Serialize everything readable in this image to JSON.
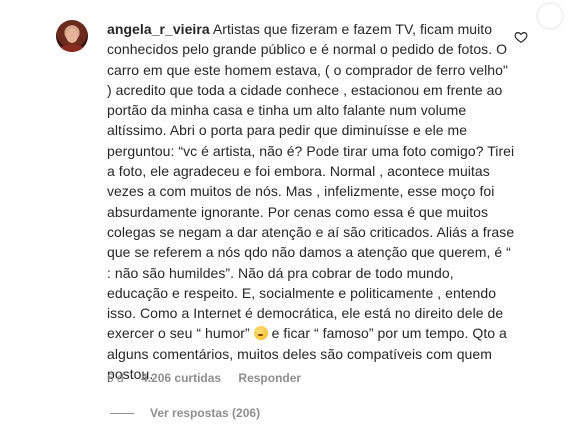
{
  "comment": {
    "username": "angela_r_vieira",
    "text": "Artistas que fizeram e fazem TV, ficam muito conhecidos pelo grande público e é normal o pedido de fotos. O carro em que este homem estava, ( o comprador de ferro velho\" ) acredito que toda a cidade conhece , estacionou em frente ao portão da minha casa e tinha um alto falante num volume altíssimo. Abri o porta para pedir que diminuísse e ele me perguntou: “vc é artista, não é? Pode tirar uma foto comigo? Tirei a foto, ele agradeceu e foi embora. Normal , acontece muitas vezes a com muitos de nós. Mas , infelizmente, esse moço foi absurdamente ignorante. Por cenas como essa é que muitos colegas se negam a dar atenção e aí são criticados. Aliás a frase que se referem a nós qdo não damos a atenção que querem, é “ : não são humildes”. Não dá pra cobrar de todo mundo, educação e respeito. E, socialmente e politicamente , entendo isso. Como a Internet é democrática, ele está no direito dele de exercer o seu “ humor”",
    "text_after_emoji": " e ficar “ famoso” por um tempo. Qto a alguns comentários, muitos deles são compatíveis com quem postou.",
    "emoji": "thinking-face",
    "age": "6 d",
    "likes": "4.206 curtidas",
    "reply_label": "Responder",
    "view_replies": "Ver respostas (206)"
  }
}
